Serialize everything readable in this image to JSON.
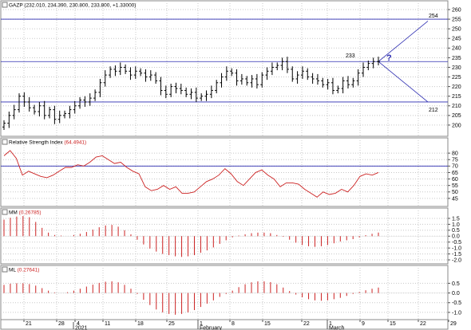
{
  "panels": {
    "price": {
      "title": "GAZP",
      "values": "(232.010, 234.390, 230.800, 233.800, +1.33000)"
    },
    "rsi": {
      "title": "Relative Strength Index",
      "value": "(64.4941)"
    },
    "mm": {
      "title": "MM",
      "value": "(0.26785)"
    },
    "ml": {
      "title": "ML",
      "value": "(0.27641)"
    }
  },
  "annotations": {
    "upper": "254",
    "level": "233",
    "lower": "212",
    "question": "?"
  },
  "x_axis": {
    "day_ticks": [
      "21",
      "28",
      "4",
      "11",
      "18",
      "25",
      "1",
      "8",
      "15",
      "22",
      "1",
      "9",
      "15",
      "22",
      "29"
    ],
    "month_labels": [
      "2021",
      "February",
      "March"
    ]
  },
  "colors": {
    "price": "#000000",
    "line": "#2a2ab0",
    "rsi": "#cc2222",
    "bars": "#cc2222",
    "grid": "#c8c8c8"
  },
  "chart_data": [
    {
      "type": "ohlc",
      "title": "GAZP",
      "ylim": [
        195,
        260
      ],
      "y_ticks": [
        200,
        205,
        210,
        215,
        220,
        225,
        230,
        235,
        240,
        245,
        250,
        255,
        260
      ],
      "horizontal_lines": [
        255,
        233,
        212
      ],
      "projection_lines": {
        "from": 233,
        "up": 254,
        "down": 212
      },
      "close": [
        201,
        205,
        208,
        215,
        212,
        209,
        207,
        210,
        205,
        208,
        203,
        205,
        206,
        208,
        210,
        213,
        212,
        214,
        217,
        222,
        226,
        229,
        228,
        230,
        228,
        226,
        228,
        227,
        225,
        226,
        223,
        218,
        216,
        220,
        219,
        218,
        216,
        217,
        214,
        215,
        216,
        218,
        222,
        225,
        228,
        227,
        223,
        224,
        222,
        224,
        221,
        226,
        228,
        230,
        231,
        233,
        229,
        224,
        226,
        228,
        225,
        224,
        223,
        221,
        222,
        218,
        219,
        223,
        221,
        223,
        227,
        230,
        232,
        233,
        233
      ]
    },
    {
      "type": "line",
      "title": "Relative Strength Index",
      "ylim": [
        40,
        85
      ],
      "y_ticks": [
        45,
        50,
        55,
        60,
        65,
        70,
        75,
        80
      ],
      "reference_line": 70,
      "values": [
        78,
        82,
        76,
        63,
        66,
        64,
        62,
        61,
        63,
        66,
        69,
        69,
        71,
        70,
        73,
        77,
        78,
        75,
        72,
        73,
        69,
        66,
        64,
        54,
        51,
        52,
        55,
        52,
        54,
        49,
        49,
        50,
        54,
        58,
        60,
        63,
        68,
        64,
        58,
        55,
        60,
        65,
        67,
        63,
        60,
        54,
        57,
        57,
        56,
        52,
        49,
        46,
        50,
        48,
        49,
        52,
        50,
        55,
        62,
        64,
        63,
        65
      ]
    },
    {
      "type": "bar",
      "title": "MM",
      "ylim": [
        -2.2,
        1.9
      ],
      "y_ticks": [
        -2.0,
        -1.5,
        -1.0,
        -0.5,
        0.0,
        0.5,
        1.0,
        1.5
      ],
      "values": [
        1.4,
        1.55,
        1.65,
        1.7,
        1.6,
        1.2,
        0.7,
        0.3,
        0.1,
        0.05,
        0.0,
        0.1,
        0.2,
        0.35,
        0.55,
        0.75,
        0.9,
        0.95,
        0.8,
        0.5,
        0.15,
        -0.3,
        -0.7,
        -1.05,
        -1.3,
        -1.5,
        -1.6,
        -1.7,
        -1.75,
        -1.7,
        -1.6,
        -1.4,
        -1.2,
        -0.95,
        -0.65,
        -0.35,
        -0.1,
        0.05,
        0.15,
        0.25,
        0.3,
        0.3,
        0.25,
        0.1,
        -0.05,
        -0.3,
        -0.55,
        -0.75,
        -0.85,
        -0.9,
        -0.85,
        -0.75,
        -0.6,
        -0.45,
        -0.35,
        -0.25,
        -0.1,
        0.08,
        0.2,
        0.3
      ]
    },
    {
      "type": "bar",
      "title": "ML",
      "ylim": [
        -1.25,
        1.05
      ],
      "y_ticks": [
        -1.0,
        -0.5,
        0.0,
        0.5
      ],
      "values": [
        0.42,
        0.48,
        0.5,
        0.5,
        0.46,
        0.38,
        0.25,
        0.12,
        0.03,
        0.0,
        0.04,
        0.12,
        0.22,
        0.33,
        0.43,
        0.52,
        0.58,
        0.6,
        0.55,
        0.42,
        0.22,
        -0.05,
        -0.35,
        -0.62,
        -0.85,
        -1.0,
        -1.08,
        -1.12,
        -1.08,
        -1.0,
        -0.88,
        -0.72,
        -0.55,
        -0.38,
        -0.2,
        -0.05,
        0.12,
        0.3,
        0.45,
        0.55,
        0.6,
        0.6,
        0.56,
        0.45,
        0.28,
        0.1,
        -0.08,
        -0.22,
        -0.32,
        -0.38,
        -0.4,
        -0.38,
        -0.32,
        -0.25,
        -0.15,
        -0.05,
        0.05,
        0.14,
        0.22,
        0.28
      ]
    }
  ]
}
